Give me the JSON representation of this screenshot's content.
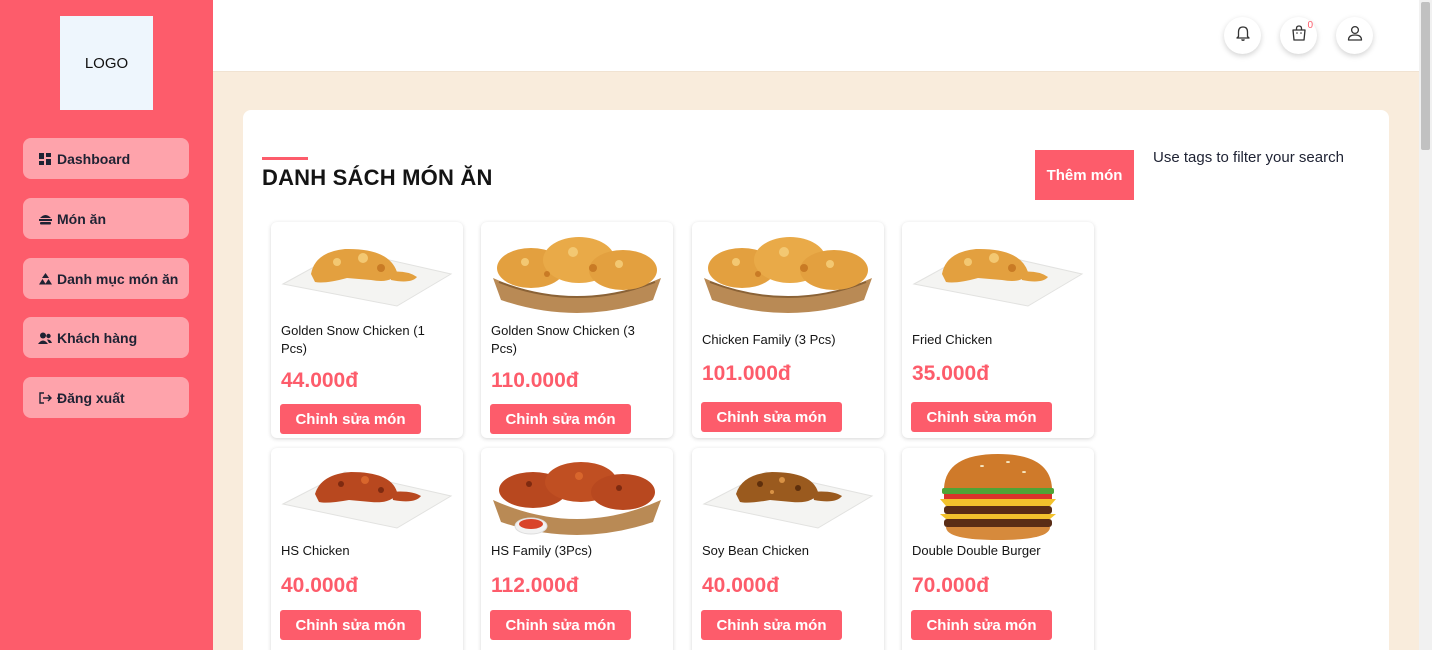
{
  "logo": {
    "text": "LOGO"
  },
  "sidebar": {
    "items": [
      {
        "label": "Dashboard",
        "icon": "grid-icon"
      },
      {
        "label": "Món ăn",
        "icon": "food-icon"
      },
      {
        "label": "Danh mục món ăn",
        "icon": "category-icon"
      },
      {
        "label": "Khách hàng",
        "icon": "users-icon"
      },
      {
        "label": "Đăng xuất",
        "icon": "logout-icon"
      }
    ]
  },
  "header": {
    "icons": [
      "bell-icon",
      "cart-icon",
      "user-icon"
    ],
    "cart_count": "0"
  },
  "main": {
    "title": "DANH SÁCH MÓN ĂN",
    "add_button": "Thêm món",
    "filter_hint": "Use tags to filter your search",
    "edit_label": "Chỉnh sửa món",
    "products": [
      {
        "name": "Golden Snow Chicken (1 Pcs)",
        "price": "44.000đ",
        "image": "fried-drumstick"
      },
      {
        "name": "Golden Snow Chicken (3 Pcs)",
        "price": "110.000đ",
        "image": "fried-basket"
      },
      {
        "name": "Chicken Family (3 Pcs)",
        "price": "101.000đ",
        "image": "fried-basket"
      },
      {
        "name": "Fried Chicken",
        "price": "35.000đ",
        "image": "fried-drumstick"
      },
      {
        "name": "HS Chicken",
        "price": "40.000đ",
        "image": "sauce-drumstick"
      },
      {
        "name": "HS Family (3Pcs)",
        "price": "112.000đ",
        "image": "sauce-basket"
      },
      {
        "name": "Soy Bean Chicken",
        "price": "40.000đ",
        "image": "soy-drumstick"
      },
      {
        "name": "Double Double Burger",
        "price": "70.000đ",
        "image": "burger"
      }
    ]
  },
  "colors": {
    "accent": "#fd5c6b",
    "nav_bg": "#fea3ab",
    "page_bg": "#f9ecdc"
  }
}
